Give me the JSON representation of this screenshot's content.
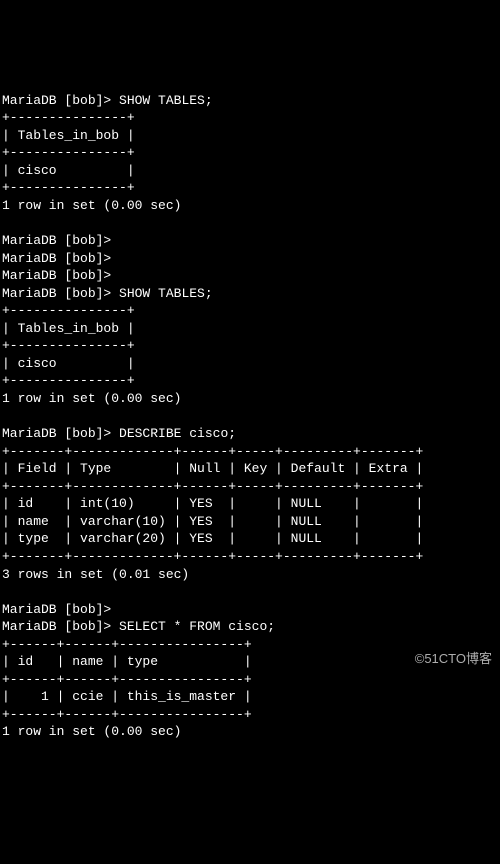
{
  "prompt_db": "MariaDB [bob]>",
  "cmd_show": "SHOW TABLES;",
  "cmd_describe": "DESCRIBE cisco;",
  "cmd_select": "SELECT * FROM cisco;",
  "tables_ruler": "+---------------+",
  "tables_header": "| Tables_in_bob |",
  "tables_row1": "| cisco         |",
  "result_1row_000": "1 row in set (0.00 sec)",
  "result_3rows_001": "3 rows in set (0.01 sec)",
  "desc_ruler": "+-------+-------------+------+-----+---------+-------+",
  "desc_header": "| Field | Type        | Null | Key | Default | Extra |",
  "desc_row_id": "| id    | int(10)     | YES  |     | NULL    |       |",
  "desc_row_name": "| name  | varchar(10) | YES  |     | NULL    |       |",
  "desc_row_type": "| type  | varchar(20) | YES  |     | NULL    |       |",
  "sel_ruler": "+------+------+----------------+",
  "sel_header": "| id   | name | type           |",
  "sel_row1": "|    1 | ccie | this_is_master |",
  "watermark": "©51CTO博客",
  "chart_data": [
    {
      "type": "table",
      "title": "Tables_in_bob",
      "columns": [
        "Tables_in_bob"
      ],
      "rows": [
        [
          "cisco"
        ]
      ]
    },
    {
      "type": "table",
      "title": "DESCRIBE cisco",
      "columns": [
        "Field",
        "Type",
        "Null",
        "Key",
        "Default",
        "Extra"
      ],
      "rows": [
        [
          "id",
          "int(10)",
          "YES",
          "",
          "NULL",
          ""
        ],
        [
          "name",
          "varchar(10)",
          "YES",
          "",
          "NULL",
          ""
        ],
        [
          "type",
          "varchar(20)",
          "YES",
          "",
          "NULL",
          ""
        ]
      ]
    },
    {
      "type": "table",
      "title": "SELECT * FROM cisco",
      "columns": [
        "id",
        "name",
        "type"
      ],
      "rows": [
        [
          1,
          "ccie",
          "this_is_master"
        ]
      ]
    }
  ]
}
